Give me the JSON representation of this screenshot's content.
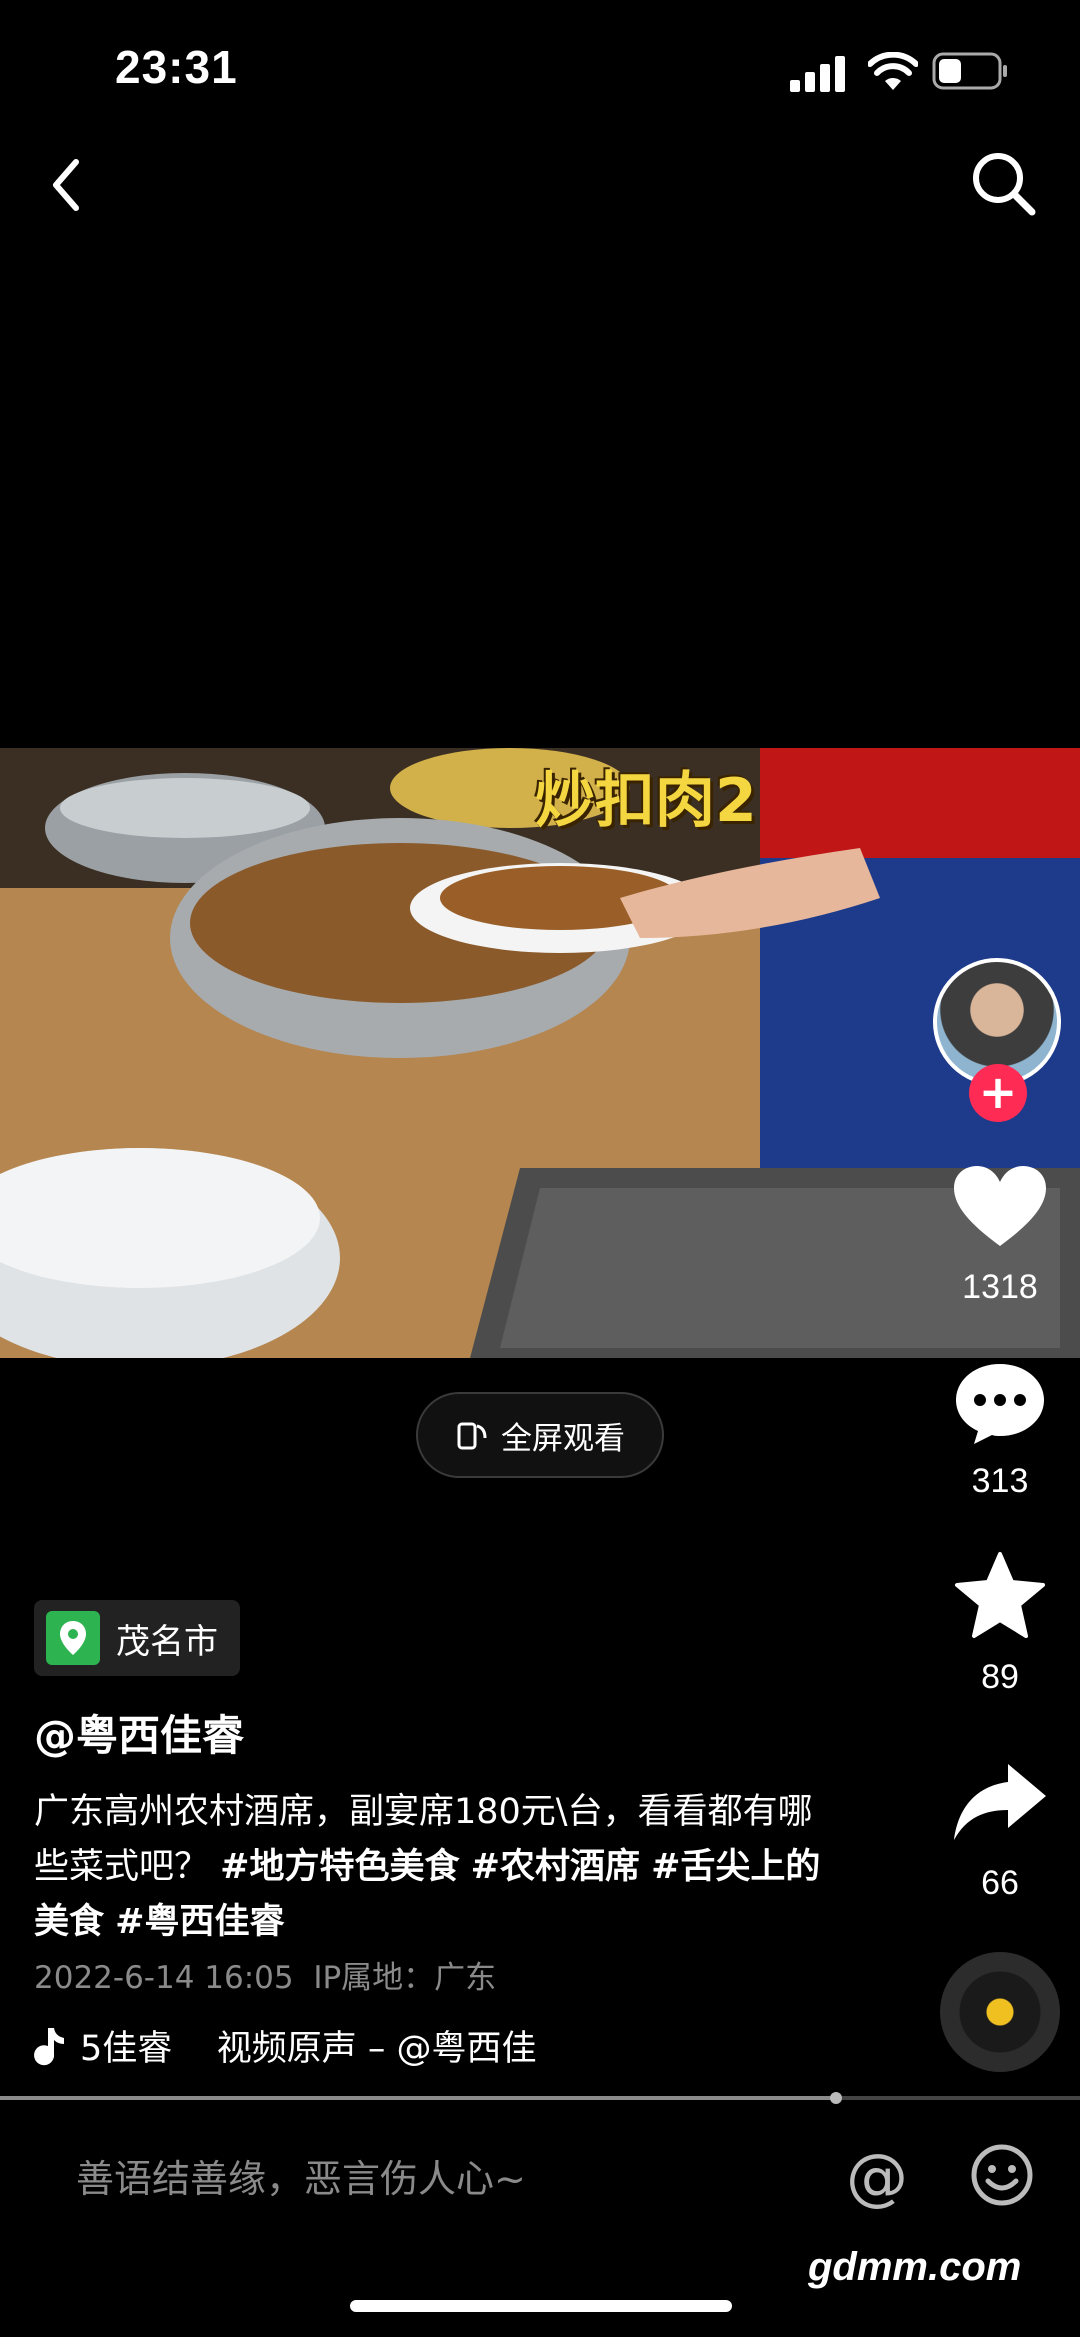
{
  "status_bar": {
    "time": "23:31"
  },
  "video": {
    "overlay_text": "炒扣肉2",
    "fullscreen_label": "全屏观看"
  },
  "actions": {
    "likes": "1318",
    "comments": "313",
    "favorites": "89",
    "shares": "66"
  },
  "post": {
    "location": "茂名市",
    "author": "@粤西佳睿",
    "caption_text": "广东高州农村酒席，副宴席180元\\台，看看都有哪些菜式吧？",
    "hashtags": [
      "#地方特色美食",
      "#农村酒席",
      "#舌尖上的美食",
      "#粤西佳睿"
    ],
    "meta": "2022-6-14 16:05  IP属地：广东",
    "music": "5佳睿    视频原声 – @粤西佳"
  },
  "comment": {
    "placeholder": "善语结善缘，恶言伤人心~"
  },
  "watermark": "gdmm.com",
  "colors": {
    "accent": "#fe2c55",
    "location_green": "#2db34f",
    "overlay_yellow": "#f4d640"
  }
}
